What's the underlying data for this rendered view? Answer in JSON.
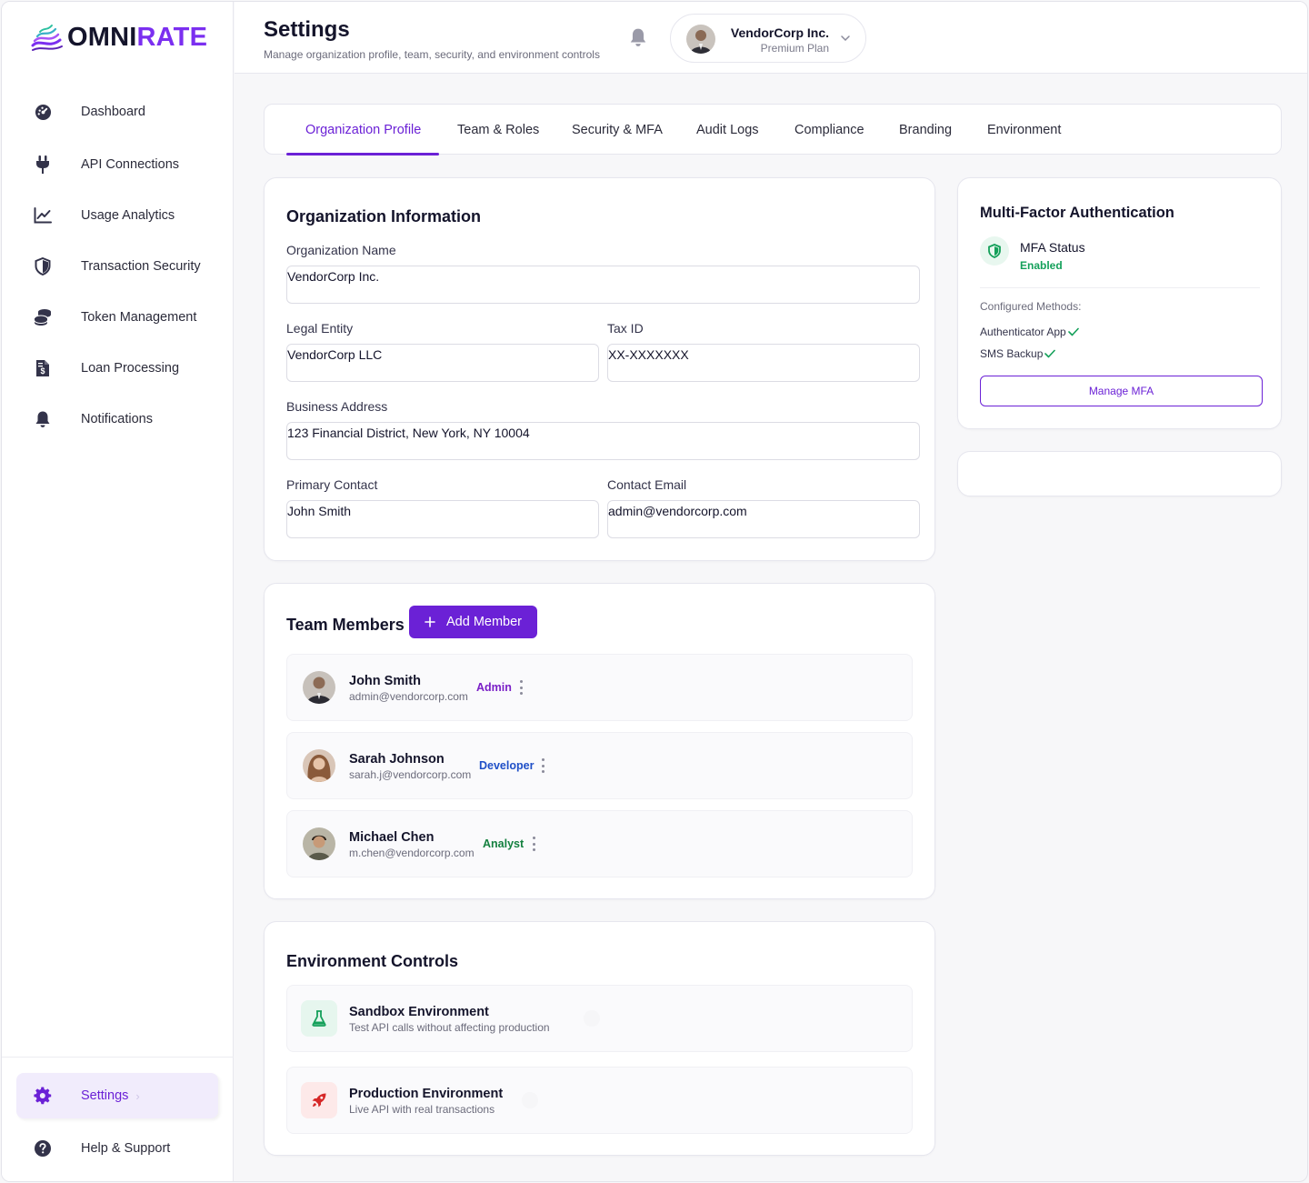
{
  "brand": {
    "part1": "OMNI",
    "part2": "RATE",
    "accent": "#7b2ff0"
  },
  "sidebar": {
    "items": [
      {
        "label": "Dashboard",
        "icon": "dashboard-icon"
      },
      {
        "label": "API Connections",
        "icon": "plug-icon"
      },
      {
        "label": "Usage Analytics",
        "icon": "chart-line-icon"
      },
      {
        "label": "Transaction Security",
        "icon": "shield-icon"
      },
      {
        "label": "Token Management",
        "icon": "coins-icon"
      },
      {
        "label": "Loan Processing",
        "icon": "invoice-icon"
      },
      {
        "label": "Notifications",
        "icon": "bell-icon"
      }
    ],
    "bottom": [
      {
        "label": "Settings",
        "icon": "gear-icon",
        "chevron": "›",
        "active": true
      },
      {
        "label": "Help & Support",
        "icon": "help-icon"
      }
    ]
  },
  "header": {
    "title": "Settings",
    "subtitle": "Manage organization profile, team, security, and environment controls",
    "account": {
      "name": "VendorCorp Inc.",
      "plan": "Premium Plan"
    }
  },
  "tabs": [
    {
      "label": "Organization Profile",
      "active": true
    },
    {
      "label": "Team & Roles"
    },
    {
      "label": "Security & MFA"
    },
    {
      "label": "Audit Logs"
    },
    {
      "label": "Compliance"
    },
    {
      "label": "Branding"
    },
    {
      "label": "Environment"
    }
  ],
  "org": {
    "title": "Organization Information",
    "name_label": "Organization Name",
    "name_value": "VendorCorp Inc.",
    "legal_label": "Legal Entity",
    "legal_value": "VendorCorp LLC",
    "tax_label": "Tax ID",
    "tax_value": "XX-XXXXXXX",
    "address_label": "Business Address",
    "address_value": "123 Financial District, New York, NY 10004",
    "contact_label": "Primary Contact",
    "contact_value": "John Smith",
    "email_label": "Contact Email",
    "email_value": "admin@vendorcorp.com"
  },
  "team": {
    "title": "Team Members",
    "add_label": "Add Member",
    "members": [
      {
        "name": "John Smith",
        "email": "admin@vendorcorp.com",
        "role": "Admin",
        "role_color": "#7a1fc7"
      },
      {
        "name": "Sarah Johnson",
        "email": "sarah.j@vendorcorp.com",
        "role": "Developer",
        "role_color": "#1f4fc7"
      },
      {
        "name": "Michael Chen",
        "email": "m.chen@vendorcorp.com",
        "role": "Analyst",
        "role_color": "#14803f"
      }
    ]
  },
  "env": {
    "title": "Environment Controls",
    "items": [
      {
        "name": "Sandbox Environment",
        "desc": "Test API calls without affecting production",
        "icon": "flask-icon"
      },
      {
        "name": "Production Environment",
        "desc": "Live API with real transactions",
        "icon": "rocket-icon"
      }
    ]
  },
  "mfa": {
    "title": "Multi-Factor Authentication",
    "status_label": "MFA Status",
    "status_value": "Enabled",
    "configured_label": "Configured Methods:",
    "methods": [
      "Authenticator App",
      "SMS Backup"
    ],
    "manage_label": "Manage MFA"
  }
}
